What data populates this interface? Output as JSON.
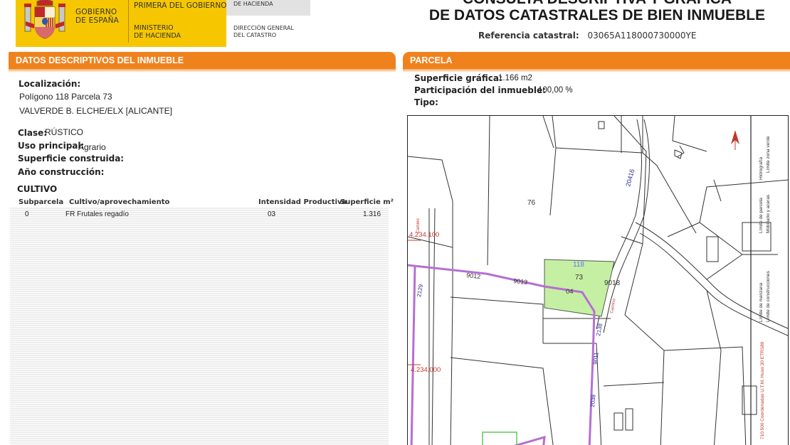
{
  "header": {
    "gov_line1": "GOBIERNO",
    "gov_line2": "DE ESPAÑA",
    "vice_presidency": "PRIMERA DEL GOBIERNO",
    "ministry_line1": "MINISTERIO",
    "ministry_line2": "DE HACIENDA",
    "hacienda_top": "DE HACIENDA",
    "directorate_line1": "DIRECCIÓN GENERAL",
    "directorate_line2": "DEL CATASTRO",
    "title_line1": "CONSULTA DESCRIPTIVA Y GRÁFICA",
    "title_line2": "DE DATOS CATASTRALES DE BIEN INMUEBLE",
    "ref_label": "Referencia catastral:",
    "ref_value": "03065A118000730000YE"
  },
  "left": {
    "section_title": "DATOS DESCRIPTIVOS DEL INMUEBLE",
    "localizacion_label": "Localización:",
    "address_line1": "Polígono 118 Parcela 73",
    "address_line2": "VALVERDE B. ELCHE/ELX [ALICANTE]",
    "clase_label": "Clase:",
    "clase_value": "RÚSTICO",
    "uso_label": "Uso principal:",
    "uso_value": "Agrario",
    "sup_construida_label": "Superficie construida:",
    "anio_label": "Año construcción:",
    "cultivo_title": "CULTIVO",
    "cultivo_headers": [
      "Subparcela",
      "Cultivo/aprovechamiento",
      "Intensidad Productiva",
      "Superficie m²"
    ],
    "cultivo_rows": [
      {
        "subparcela": "0",
        "cultivo": "FR Frutales regadío",
        "intensidad": "03",
        "superficie": "1.316"
      }
    ]
  },
  "right": {
    "section_title": "PARCELA",
    "sup_grafica_label": "Superficie gráfica:",
    "sup_grafica_value": "1.166 m2",
    "participacion_label": "Participación del inmueble:",
    "participacion_value": "100,00 %",
    "tipo_label": "Tipo:",
    "map": {
      "parcel_labels": [
        "76",
        "118",
        "73",
        "04",
        "9018",
        "9012",
        "9013",
        "20416",
        "2138",
        "9011",
        "2038",
        "2129"
      ],
      "coord_labels": [
        "4.234.100",
        "4.234.000",
        "Camino",
        "Camino"
      ],
      "legend_items": [
        "Límite de manzana",
        "Límite de parcela",
        "Hidrografía",
        "Límite de construcciones",
        "Mobiliario y aceras",
        "Límite zona verde"
      ],
      "coordinates_note": "710.500 Coordenadas U.T.M. Huso 30 ETRS89"
    }
  },
  "colors": {
    "section_orange": "#f0821e",
    "header_yellow": "#f6c700",
    "parcel_fill": "#c5f0a3",
    "boundary_purple": "#b56fd2",
    "coord_red": "#c0392b"
  }
}
